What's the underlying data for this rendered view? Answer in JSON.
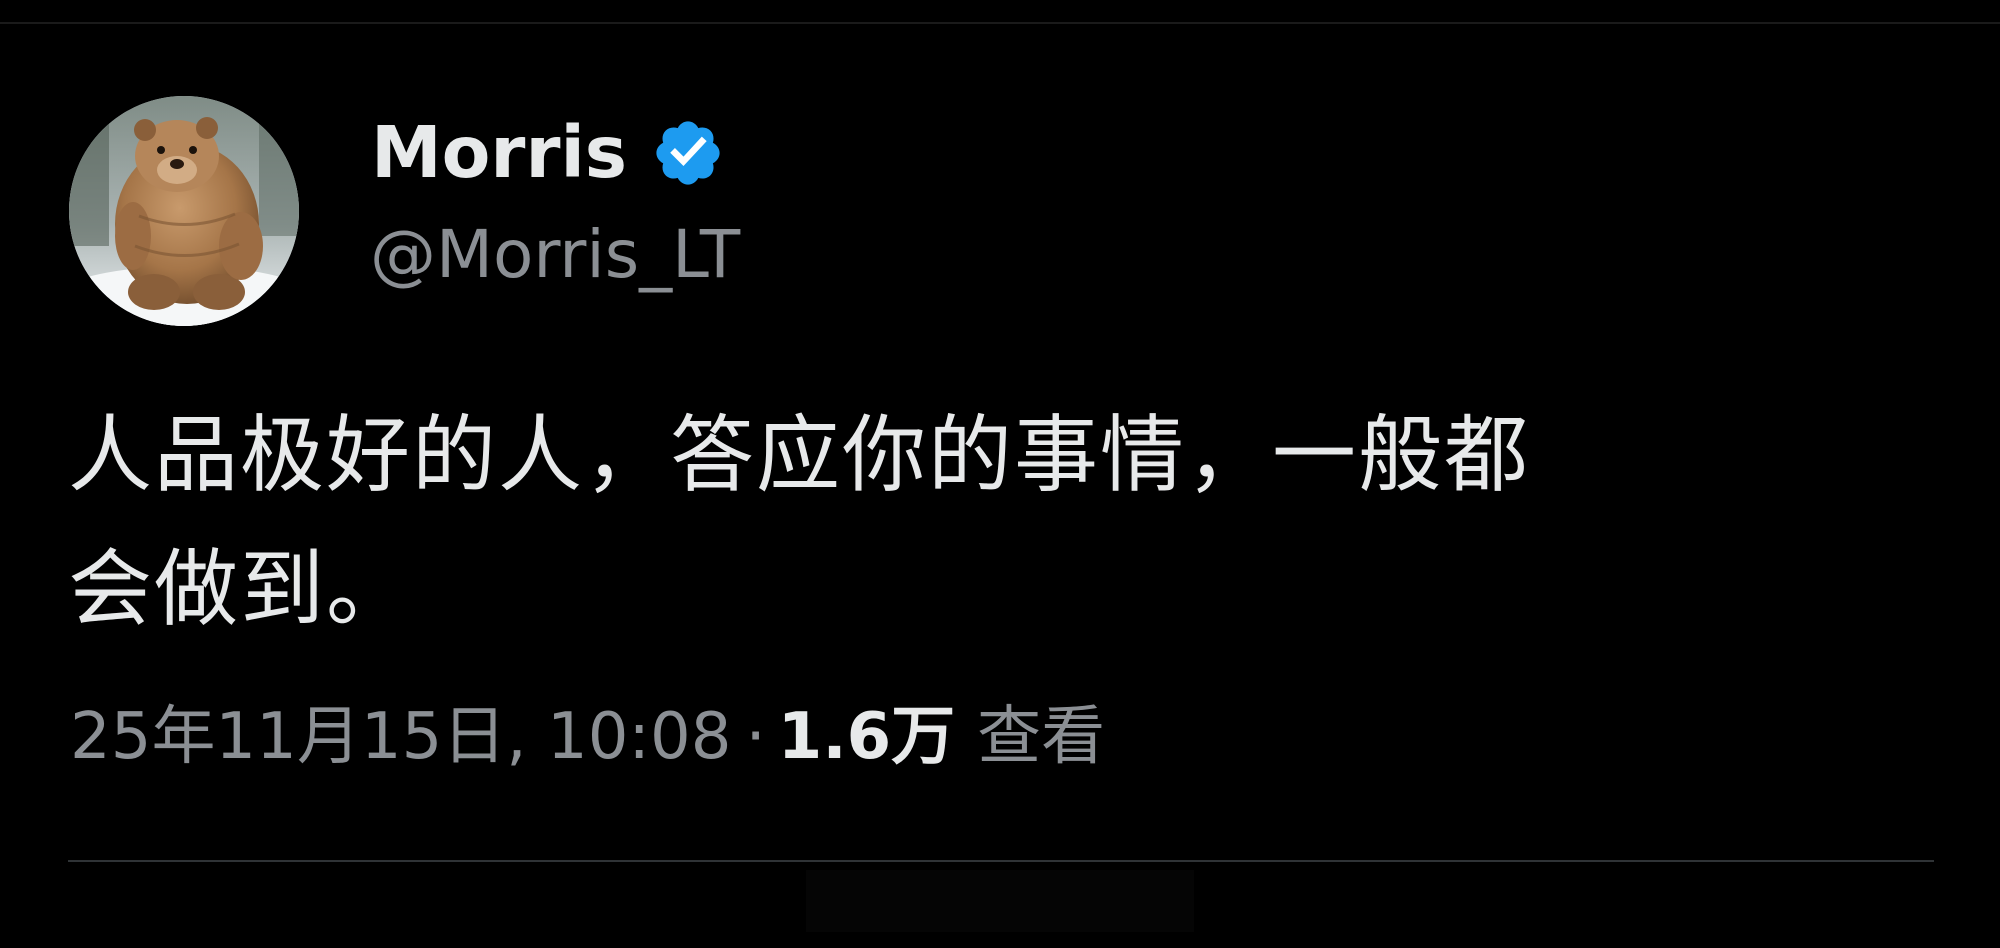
{
  "colors": {
    "background": "#000000",
    "primary_text": "#e7e9ea",
    "secondary_text": "#8b8f94",
    "verified_badge": "#1d9bf0",
    "divider": "#2f3336"
  },
  "author": {
    "avatar_icon": "bear-avatar",
    "display_name": "Morris",
    "verified_icon": "verified-badge-icon",
    "handle": "@Morris_LT"
  },
  "tweet": {
    "text_lines": [
      "人品极好的人，答应你的事情，一般都",
      "会做到。"
    ]
  },
  "meta": {
    "timestamp": "25年11月15日, 10:08",
    "separator": "·",
    "views_count": "1.6万",
    "views_label": "查看"
  }
}
